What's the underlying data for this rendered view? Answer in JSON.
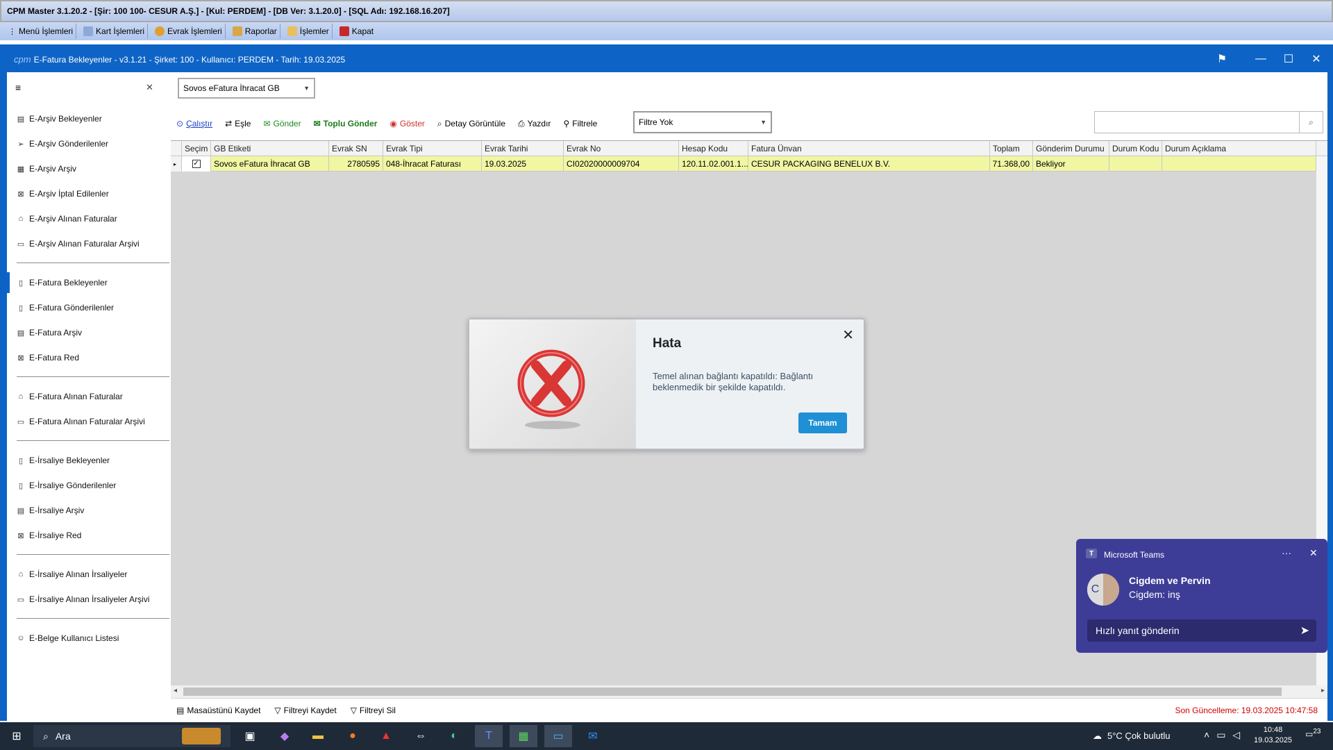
{
  "titlebar": {
    "text": "CPM Master 3.1.20.2 - [Şir: 100 100- CESUR A.Ş.] - [Kul: PERDEM] - [DB Ver: 3.1.20.0] - [SQL Adı: 192.168.16.207]"
  },
  "menubar": {
    "items": [
      "Menü İşlemleri",
      "Kart İşlemleri",
      "Evrak İşlemleri",
      "Raporlar",
      "İşlemler",
      "Kapat"
    ]
  },
  "app": {
    "logo": "cpm",
    "title": "E-Fatura Bekleyenler - v3.1.21 - Şirket: 100 - Kullanıcı: PERDEM - Tarih: 19.03.2025"
  },
  "sidebar": {
    "groups": [
      [
        "E-Arşiv Bekleyenler",
        "E-Arşiv Gönderilenler",
        "E-Arşiv Arşiv",
        "E-Arşiv İptal Edilenler",
        "E-Arşiv Alınan Faturalar",
        "E-Arşiv Alınan Faturalar Arşivi"
      ],
      [
        "E-Fatura Bekleyenler",
        "E-Fatura Gönderilenler",
        "E-Fatura Arşiv",
        "E-Fatura Red"
      ],
      [
        "E-Fatura Alınan Faturalar",
        "E-Fatura Alınan Faturalar Arşivi"
      ],
      [
        "E-İrsaliye Bekleyenler",
        "E-İrsaliye Gönderilenler",
        "E-İrsaliye Arşiv",
        "E-İrsaliye Red"
      ],
      [
        "E-İrsaliye Alınan İrsaliyeler",
        "E-İrsaliye Alınan İrsaliyeler Arşivi"
      ],
      [
        "E-Belge Kullanıcı Listesi"
      ]
    ]
  },
  "source_select": {
    "value": "Sovos eFatura İhracat GB"
  },
  "toolbar": {
    "calistir": "Çalıştır",
    "esle": "Eşle",
    "gonder": "Gönder",
    "toplu_gonder": "Toplu Gönder",
    "goster": "Göster",
    "detay": "Detay Görüntüle",
    "yazdir": "Yazdır",
    "filtrele": "Filtrele"
  },
  "filter_select": {
    "value": "Filtre Yok"
  },
  "grid": {
    "columns": [
      "Seçim",
      "GB Etiketi",
      "Evrak SN",
      "Evrak Tipi",
      "Evrak Tarihi",
      "Evrak No",
      "Hesap Kodu",
      "Fatura Ünvan",
      "Toplam",
      "Gönderim Durumu",
      "Durum Kodu",
      "Durum Açıklama"
    ],
    "rows": [
      {
        "secim": "✓",
        "gb": "Sovos eFatura İhracat GB",
        "sn": "2780595",
        "tip": "048-İhracat Faturası",
        "tarih": "19.03.2025",
        "no": "CI02020000009704",
        "hesap": "120.11.02.001.1...",
        "unvan": "CESUR PACKAGING BENELUX B.V.",
        "toplam": "71.368,00",
        "durum": "Bekliyor",
        "kod": "",
        "aciklama": ""
      }
    ]
  },
  "statusbar": {
    "masaustu": "Masaüstünü Kaydet",
    "filtre_kaydet": "Filtreyi Kaydet",
    "filtre_sil": "Filtreyi Sil",
    "last_update": "Son Güncelleme: 19.03.2025 10:47:58"
  },
  "dialog": {
    "title": "Hata",
    "message": "Temel alınan bağlantı kapatıldı: Bağlantı beklenmedik bir şekilde kapatıldı.",
    "ok": "Tamam"
  },
  "teams": {
    "app": "Microsoft Teams",
    "sender": "Cigdem ve Pervin",
    "preview": "Cigdem: inş",
    "avatar": "C",
    "quick_reply": "Hızlı yanıt gönderin"
  },
  "taskbar": {
    "search": "Ara",
    "weather": "5°C  Çok bulutlu",
    "time": "10:48",
    "date": "19.03.2025",
    "notif": "23"
  },
  "colors": {
    "accent": "#0e64c6",
    "row_highlight": "#f0f6a2",
    "error": "#d00000",
    "ok_button": "#1f8fd6",
    "teams": "#3d3d98"
  }
}
